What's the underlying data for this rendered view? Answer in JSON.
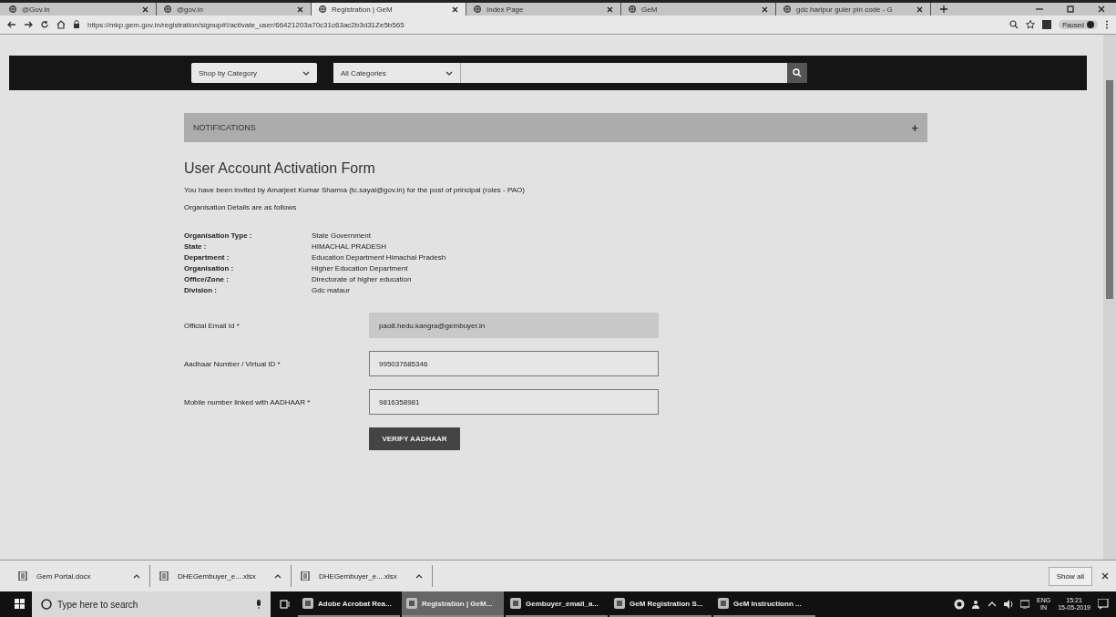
{
  "tabs": [
    {
      "title": "@Gov.in",
      "selected": false
    },
    {
      "title": "@gov.in",
      "selected": false
    },
    {
      "title": "Registration | GeM",
      "selected": true
    },
    {
      "title": "Index Page",
      "selected": false
    },
    {
      "title": "GeM",
      "selected": false
    },
    {
      "title": "gdc haripur guler pin code - G",
      "selected": false
    }
  ],
  "address_bar": {
    "url": "https://mkp.gem.gov.in/registration/signup#!/activate_user/66421203a70c31c63ac2b3d31Ze5b565",
    "profile": "Paused"
  },
  "nav": {
    "category_select": "Shop by Category",
    "search_category": "All Categories"
  },
  "notifications": {
    "title": "NOTIFICATIONS",
    "toggle": "+"
  },
  "form": {
    "heading": "User Account Activation Form",
    "intro": "You have been invited by Amarjeet Kumar Sharma (tc.sayal@gov.in) for the post of principal (roles - PAO)",
    "details_heading": "Organisation Details are as follows",
    "details": [
      {
        "label": "Organisation Type :",
        "value": "State Government"
      },
      {
        "label": "State :",
        "value": "HIMACHAL PRADESH"
      },
      {
        "label": "Department :",
        "value": "Education Department Himachal Pradesh"
      },
      {
        "label": "Organisation :",
        "value": "Higher Education Department"
      },
      {
        "label": "Office/Zone :",
        "value": "Directorate of higher education"
      },
      {
        "label": "Division :",
        "value": "Gdc mataur"
      }
    ],
    "fields": [
      {
        "label": "Official Email Id *",
        "value": "pao8.hedu.kangra@gembuyer.in",
        "disabled": true
      },
      {
        "label": "Aadhaar Number / Virtual ID *",
        "value": "995037685346",
        "disabled": false
      },
      {
        "label": "Mobile number linked with AADHAAR *",
        "value": "9816358981",
        "disabled": false
      }
    ],
    "button": "VERIFY AADHAAR"
  },
  "downloads": {
    "items": [
      {
        "name": "Gem Portal.docx"
      },
      {
        "name": "DHEGembuyer_e....xlsx"
      },
      {
        "name": "DHEGembuyer_e....xlsx"
      }
    ],
    "show_all": "Show all"
  },
  "taskbar": {
    "search_placeholder": "Type here to search",
    "apps": [
      {
        "title": "Adobe Acrobat Rea...",
        "selected": false
      },
      {
        "title": "Registration | GeM...",
        "selected": true
      },
      {
        "title": "Gembuyer_email_a...",
        "selected": false
      },
      {
        "title": "GeM Registration S...",
        "selected": false
      },
      {
        "title": "GeM Instructionn ...",
        "selected": false
      }
    ],
    "language": "ENG",
    "region": "IN",
    "time": "15:21",
    "date": "15-05-2019"
  }
}
